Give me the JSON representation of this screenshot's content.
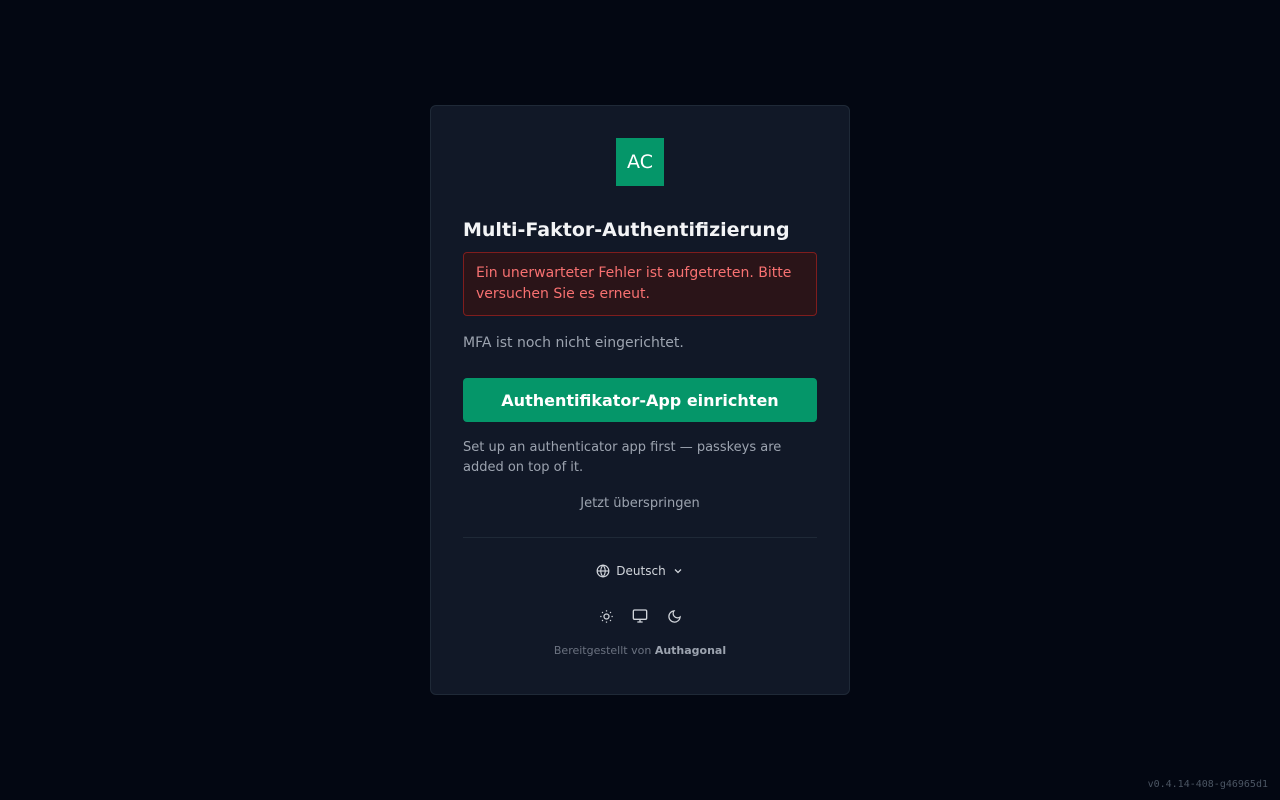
{
  "logo": {
    "text": "AC"
  },
  "title": "Multi-Faktor-Authentifizierung",
  "error": {
    "message": "Ein unerwarteter Fehler ist aufgetreten. Bitte versuchen Sie es erneut."
  },
  "status_text": "MFA ist noch nicht eingerichtet.",
  "primary_button": {
    "label": "Authentifikator-App einrichten"
  },
  "hint_text": "Set up an authenticator app first — passkeys are added on top of it.",
  "skip_link": {
    "label": "Jetzt überspringen"
  },
  "language": {
    "selected": "Deutsch",
    "icon": "globe-icon"
  },
  "theme": {
    "options": [
      "light",
      "system",
      "dark"
    ],
    "icons": [
      "sun-icon",
      "monitor-icon",
      "moon-icon"
    ]
  },
  "footer": {
    "powered_prefix": "Bereitgestellt von",
    "powered_brand": "Authagonal"
  },
  "version": "v0.4.14-408-g46965d1",
  "colors": {
    "accent": "#059669",
    "error": "#f87171",
    "background": "#030712",
    "card": "#111827"
  }
}
